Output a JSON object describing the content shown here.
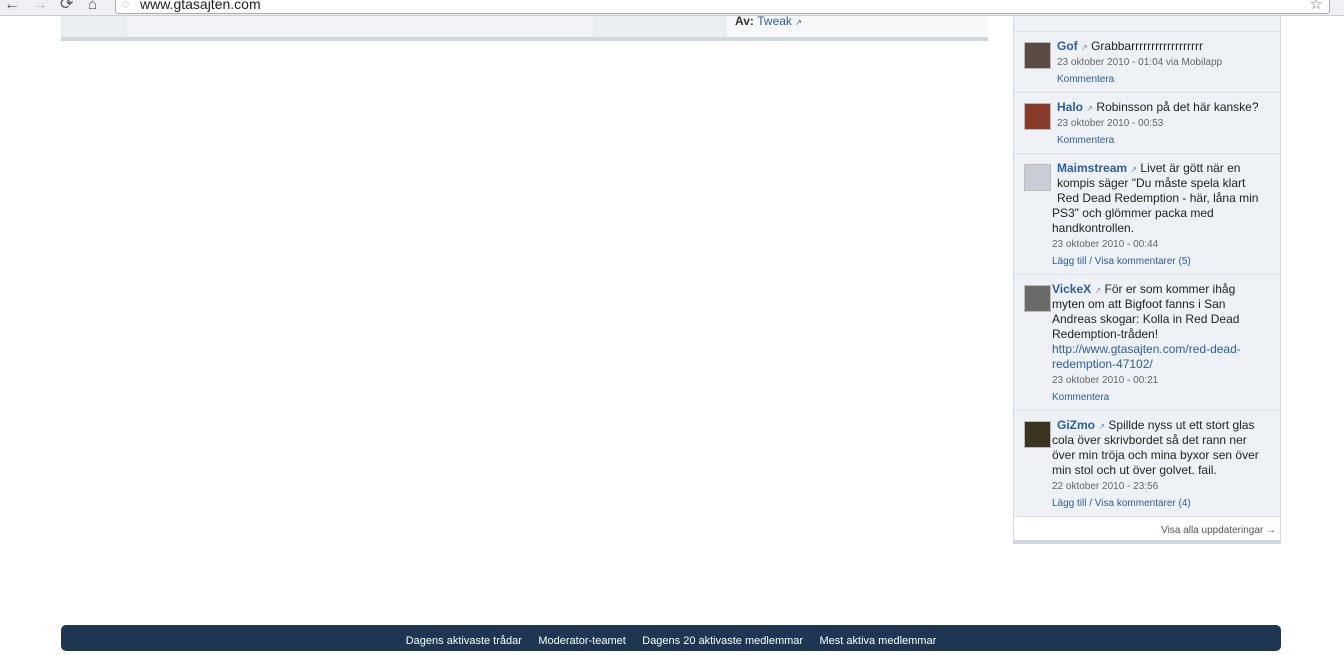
{
  "browser": {
    "url": "www.gtasajten.com",
    "back_glyph": "←",
    "forward_glyph": "→",
    "reload_glyph": "⟳",
    "home_glyph": "⌂",
    "globe_glyph": "◌",
    "star_glyph": "☆"
  },
  "content_strip": {
    "author_prefix": "Av:",
    "author_name": "Tweak"
  },
  "updates": [
    {
      "name": "Gof",
      "text": "Grabbarrrrrrrrrrrrrrrrrr",
      "date": "23 oktober 2010 - 01:04 via Mobilapp",
      "action": "Kommentera",
      "avatar_color": "#5a4a44"
    },
    {
      "name": "Halo",
      "text": "Robinsson på det här kanske?",
      "date": "23 oktober 2010 - 00:53",
      "action": "Kommentera",
      "avatar_color": "#8a3a2a"
    },
    {
      "name": "Maimstream",
      "text_lines": [
        "Livet är gött när en",
        "kompis säger \"Du måste spela klart",
        "Red Dead Redemption - här, låna min",
        "PS3\" och glömmer packa med",
        "handkontrollen."
      ],
      "date": "23 oktober 2010 - 00:44",
      "action": "Lägg till / Visa kommentarer (5)",
      "avatar_color": "#c9ced6"
    },
    {
      "name": "VickeX",
      "text_lines": [
        "För er som kommer ihåg",
        "myten om att Bigfoot fanns i San",
        "Andreas skogar: Kolla in Red Dead",
        "Redemption-tråden!"
      ],
      "link_lines": [
        "http://www.gtasajten.com/red-dead-",
        "redemption-47102/"
      ],
      "date": "23 oktober 2010 - 00:21",
      "action": "Kommentera",
      "avatar_color": "#6b6b6b"
    },
    {
      "name": "GiZmo",
      "text_lines": [
        "Spillde nyss ut ett stort glas",
        "cola över skrivbordet så det rann ner",
        "över min tröja och mina byxor sen över",
        "min stol och ut över golvet. fail."
      ],
      "date": "22 oktober 2010 - 23:56",
      "action": "Lägg till / Visa kommentarer (4)",
      "avatar_color": "#3b3320"
    }
  ],
  "view_all": "Visa alla uppdateringar →",
  "footer": {
    "links": [
      "Dagens aktivaste trådar",
      "Moderator-teamet",
      "Dagens 20 aktivaste medlemmar",
      "Mest aktiva medlemmar"
    ]
  }
}
